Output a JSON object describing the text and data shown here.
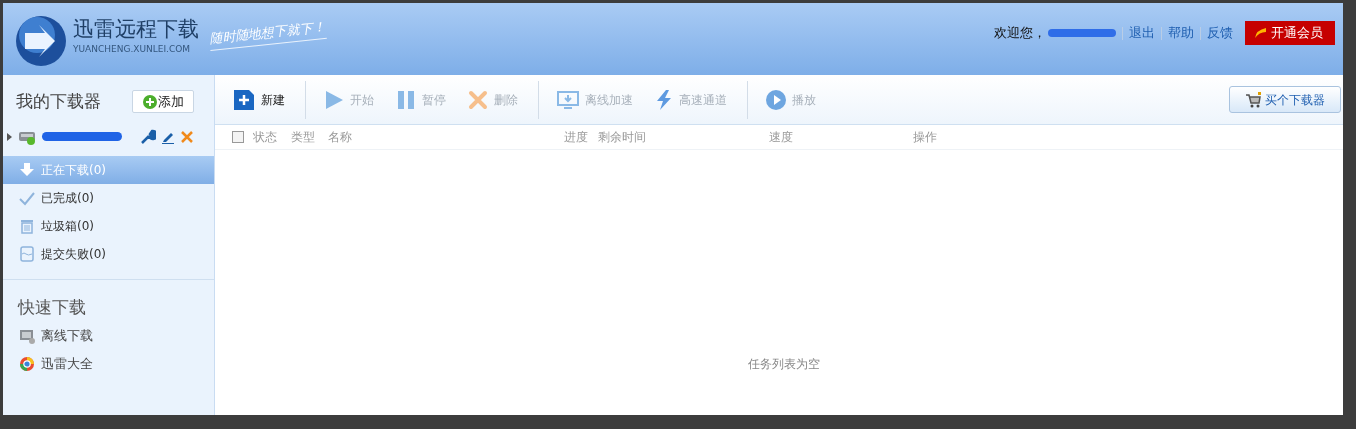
{
  "header": {
    "title": "迅雷远程下载",
    "domain": "YUANCHENG.XUNLEI.COM",
    "slogan": "随时随地想下就下！",
    "welcome": "欢迎您，",
    "links": [
      "退出",
      "帮助",
      "反馈"
    ],
    "vip_button": "开通会员"
  },
  "sidebar": {
    "heading": "我的下载器",
    "add_button": "添加",
    "device": {
      "expanded": false
    },
    "items": [
      {
        "label": "正在下载(0)",
        "kind": "downloading",
        "selected": true
      },
      {
        "label": "已完成(0)",
        "kind": "done",
        "selected": false
      },
      {
        "label": "垃圾箱(0)",
        "kind": "trash",
        "selected": false
      },
      {
        "label": "提交失败(0)",
        "kind": "failed",
        "selected": false
      }
    ],
    "quick_heading": "快速下载",
    "quick_items": [
      {
        "label": "离线下载",
        "kind": "offline"
      },
      {
        "label": "迅雷大全",
        "kind": "browser"
      }
    ]
  },
  "toolbar": {
    "buttons": [
      {
        "label": "新建",
        "kind": "new",
        "disabled": false,
        "divider_after": true
      },
      {
        "label": "开始",
        "kind": "start",
        "disabled": true,
        "divider_after": false
      },
      {
        "label": "暂停",
        "kind": "pause",
        "disabled": true,
        "divider_after": false
      },
      {
        "label": "删除",
        "kind": "delete",
        "disabled": true,
        "divider_after": true
      },
      {
        "label": "离线加速",
        "kind": "offline",
        "disabled": true,
        "divider_after": false
      },
      {
        "label": "高速通道",
        "kind": "fast",
        "disabled": true,
        "divider_after": true
      },
      {
        "label": "播放",
        "kind": "play",
        "disabled": true,
        "divider_after": false
      }
    ],
    "buy_button": "买个下载器"
  },
  "table": {
    "select_all": {
      "checked": false
    },
    "columns": [
      "状态",
      "类型",
      "名称",
      "进度",
      "剩余时间",
      "速度",
      "操作"
    ],
    "empty_text": "任务列表为空"
  }
}
